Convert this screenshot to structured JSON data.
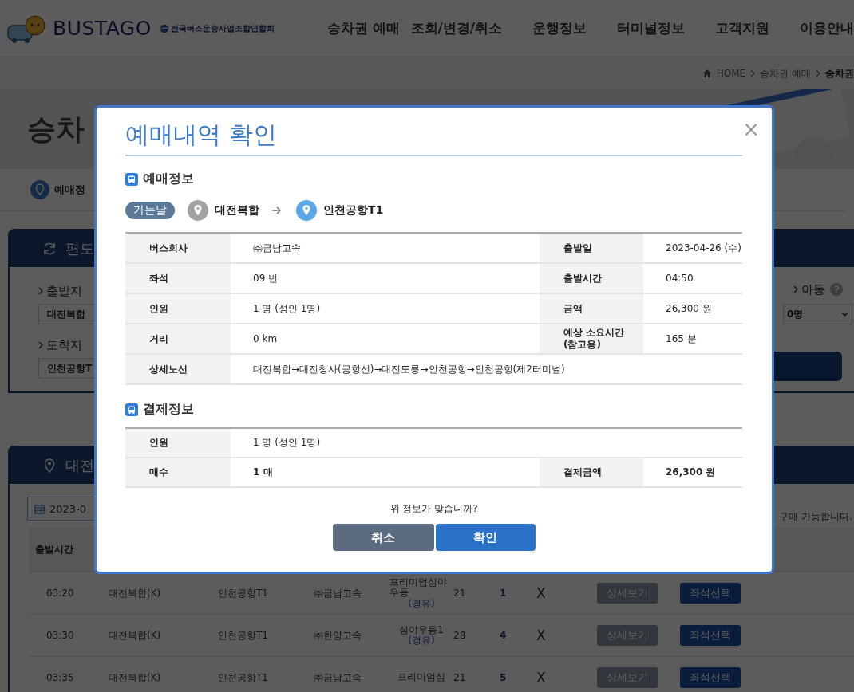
{
  "header": {
    "logo": "BUSTAGO",
    "association": "전국버스운송사업조합연합회",
    "nav": [
      "승차권 예매",
      "조회/변경/취소",
      "운행정보",
      "터미널정보",
      "고객지원",
      "이용안내"
    ]
  },
  "breadcrumb": [
    "HOME",
    "승차권 예매",
    "승차권"
  ],
  "page_title": "승차",
  "step": "예매정",
  "search_panel": {
    "title": "편도",
    "origin": {
      "label": "출발지",
      "value": "대전복합"
    },
    "destination": {
      "label": "도착지",
      "value": "인천공항T"
    },
    "child": {
      "label": "아동",
      "value": "0명"
    }
  },
  "schedule_panel": {
    "title": "대전",
    "date": "2023-0",
    "notice": "구매 가능합니다.",
    "columns": [
      "출발시간"
    ],
    "rows": [
      {
        "time": "03:20",
        "from": "대전복합(K)",
        "to": "인천공항T1",
        "company": "㈜금남고속",
        "grade": "프리미엄심야우등",
        "via": "(경유)",
        "column_6": "21",
        "column_7": "1",
        "column_8": "X",
        "detail_button": "상세보기",
        "select_button": "좌석선택"
      },
      {
        "time": "03:30",
        "from": "대전복합(K)",
        "to": "인천공항T1",
        "company": "㈜한양고속",
        "grade": "심야우등1",
        "via": "(경유)",
        "column_6": "28",
        "column_7": "4",
        "column_8": "X",
        "detail_button": "상세보기",
        "select_button": "좌석선택"
      },
      {
        "time": "03:35",
        "from": "대전복합(K)",
        "to": "인천공항T1",
        "company": "㈜금남고속",
        "grade": "프리미엄심",
        "column_6": "21",
        "column_7": "5",
        "column_8": "X",
        "detail_button": "상세보기",
        "select_button": "좌석선택"
      }
    ]
  },
  "modal": {
    "title": "예매내역 확인",
    "close": "×",
    "booking": {
      "heading": "예매정보",
      "trip_badge": "가는날",
      "origin": "대전복합",
      "destination": "인천공항T1",
      "rows": [
        [
          {
            "label": "버스회사",
            "value": "㈜금남고속"
          },
          {
            "label": "출발일",
            "value": "2023-04-26 (수)"
          }
        ],
        [
          {
            "label": "좌석",
            "value": "09 번"
          },
          {
            "label": "출발시간",
            "value": "04:50"
          }
        ],
        [
          {
            "label": "인원",
            "value": "1 명 (성인 1명)"
          },
          {
            "label": "금액",
            "value": "26,300 원"
          }
        ],
        [
          {
            "label": "거리",
            "value": "0 km"
          },
          {
            "label": "예상 소요시간 (참고용)",
            "value": "165 분"
          }
        ],
        [
          {
            "label": "상세노선",
            "value": "대전복합→대전청사(공항선)→대전도룡→인천공항→인천공항(제2터미널)"
          }
        ]
      ]
    },
    "payment": {
      "heading": "결제정보",
      "rows": [
        [
          {
            "label": "인원",
            "value": "1 명 (성인 1명)",
            "bold": false
          }
        ],
        [
          {
            "label": "매수",
            "value": "1 매",
            "bold": true
          },
          {
            "label": "결제금액",
            "value": "26,300 원",
            "bold": true
          }
        ]
      ]
    },
    "question": "위 정보가 맞습니까?",
    "buttons": [
      {
        "label": "취소",
        "kind": "secondary"
      },
      {
        "label": "확인",
        "kind": "primary"
      }
    ]
  }
}
